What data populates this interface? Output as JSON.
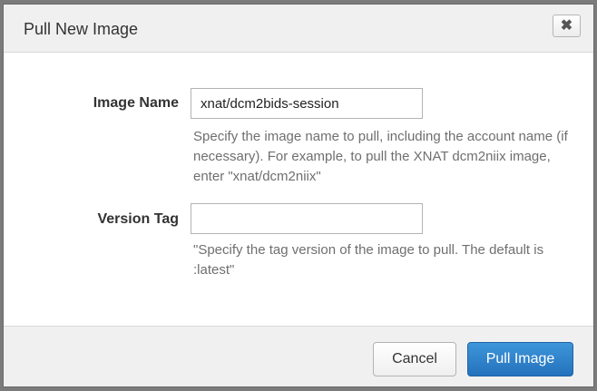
{
  "dialog": {
    "title": "Pull New Image",
    "close_icon": "close-icon",
    "close_glyph": "✖"
  },
  "form": {
    "image_name": {
      "label": "Image Name",
      "value": "xnat/dcm2bids-session",
      "help": "Specify the image name to pull, including the account name (if necessary). For example, to pull the XNAT dcm2niix image, enter \"xnat/dcm2niix\""
    },
    "version_tag": {
      "label": "Version Tag",
      "value": "",
      "help": "\"Specify the tag version of the image to pull. The default is :latest\""
    }
  },
  "footer": {
    "cancel_label": "Cancel",
    "submit_label": "Pull Image"
  },
  "colors": {
    "primary": "#2a7ec7",
    "header_bg": "#f0f0f0",
    "help_text": "#6f6f6f"
  }
}
